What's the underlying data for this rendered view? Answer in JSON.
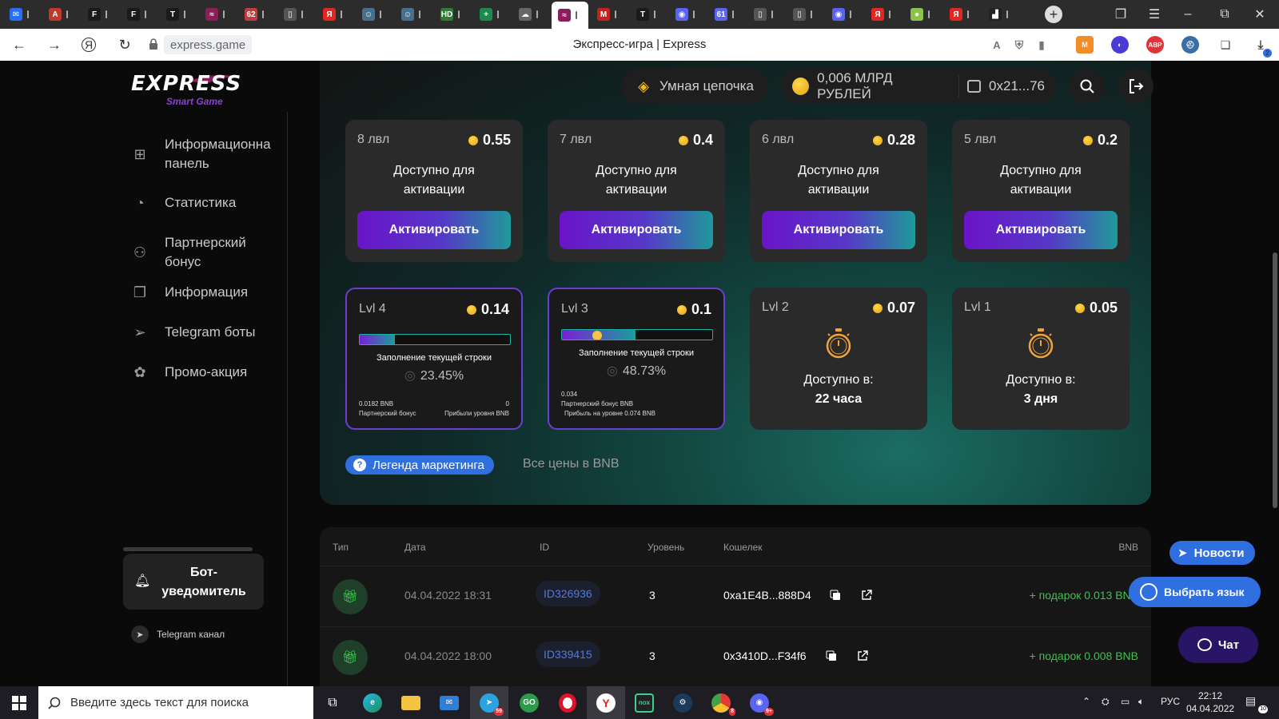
{
  "browser": {
    "tabs": [
      {
        "icon": "msg-icon",
        "color": "#2a6df5",
        "glyph": "✉",
        "badge": ""
      },
      {
        "icon": "app-icon",
        "color": "#c0392b",
        "glyph": "A",
        "badge": ""
      },
      {
        "icon": "f-icon",
        "color": "#1a1a1a",
        "glyph": "F",
        "badge": ""
      },
      {
        "icon": "f-icon",
        "color": "#1a1a1a",
        "glyph": "F",
        "badge": ""
      },
      {
        "icon": "t-icon",
        "color": "#1a1a1a",
        "glyph": "T",
        "badge": ""
      },
      {
        "icon": "express-icon",
        "color": "#8b1d5a",
        "glyph": "≈",
        "badge": ""
      },
      {
        "icon": "badge-icon",
        "color": "#c23b3b",
        "glyph": "62",
        "badge": "62"
      },
      {
        "icon": "doc-icon",
        "color": "#555",
        "glyph": "▯",
        "badge": ""
      },
      {
        "icon": "yandex-icon",
        "color": "#e52620",
        "glyph": "Я",
        "badge": ""
      },
      {
        "icon": "mask-icon",
        "color": "#4a6f8a",
        "glyph": "☺",
        "badge": ""
      },
      {
        "icon": "mask-icon",
        "color": "#4a6f8a",
        "glyph": "☺",
        "badge": ""
      },
      {
        "icon": "hd-icon",
        "color": "#2e7d32",
        "glyph": "HD",
        "badge": ""
      },
      {
        "icon": "sheet-icon",
        "color": "#1b8a4a",
        "glyph": "+",
        "badge": ""
      },
      {
        "icon": "cloud-icon",
        "color": "#666",
        "glyph": "☁",
        "badge": ""
      },
      {
        "icon": "express-icon",
        "color": "#8b1d5a",
        "glyph": "≈",
        "badge": ""
      },
      {
        "icon": "gmail-icon",
        "color": "#c5221f",
        "glyph": "M",
        "badge": ""
      },
      {
        "icon": "t-icon",
        "color": "#1a1a1a",
        "glyph": "T",
        "badge": ""
      },
      {
        "icon": "discord-icon",
        "color": "#5865f2",
        "glyph": "◉",
        "badge": ""
      },
      {
        "icon": "badge-icon",
        "color": "#5865f2",
        "glyph": "61",
        "badge": "61"
      },
      {
        "icon": "doc-icon",
        "color": "#555",
        "glyph": "▯",
        "badge": ""
      },
      {
        "icon": "doc-icon",
        "color": "#555",
        "glyph": "▯",
        "badge": ""
      },
      {
        "icon": "discord-icon",
        "color": "#5865f2",
        "glyph": "◉",
        "badge": ""
      },
      {
        "icon": "yandex-icon",
        "color": "#e52620",
        "glyph": "Я",
        "badge": ""
      },
      {
        "icon": "ball-icon",
        "color": "#8bc34a",
        "glyph": "●",
        "badge": ""
      },
      {
        "icon": "yandex-icon",
        "color": "#e52620",
        "glyph": "Я",
        "badge": ""
      },
      {
        "icon": "chart-icon",
        "color": "#222",
        "glyph": "▟",
        "badge": ""
      }
    ],
    "url": "express.game",
    "page_title": "Экспресс-игра | Express",
    "download_count": "2"
  },
  "header": {
    "logo_text": "EXPRESS",
    "logo_sub": "Smart Game",
    "chain_label": "Умная цепочка",
    "balance": "0,006 МЛРД РУБЛЕЙ",
    "wallet": "0x21...76"
  },
  "sidebar": {
    "items": [
      {
        "label": "Информационна панель",
        "icon": "dashboard-icon"
      },
      {
        "label": "Статистика",
        "icon": "stats-icon"
      },
      {
        "label": "Партнерский бонус",
        "icon": "partner-icon"
      },
      {
        "label": "Информация",
        "icon": "info-icon"
      },
      {
        "label": "Telegram боты",
        "icon": "telegram-icon"
      },
      {
        "label": "Промо-акция",
        "icon": "promo-icon"
      }
    ],
    "bot_label": "Бот-уведомитель",
    "telegram_channel": "Telegram канал"
  },
  "levels_top": [
    {
      "level": "8 лвл",
      "price": "0.55",
      "status": "Доступно для активации",
      "button": "Активировать"
    },
    {
      "level": "7 лвл",
      "price": "0.4",
      "status": "Доступно для активации",
      "button": "Активировать"
    },
    {
      "level": "6 лвл",
      "price": "0.28",
      "status": "Доступно для активации",
      "button": "Активировать"
    },
    {
      "level": "5 лвл",
      "price": "0.2",
      "status": "Доступно для активации",
      "button": "Активировать"
    }
  ],
  "levels_active": [
    {
      "level": "Lvl 4",
      "price": "0.14",
      "fill_caption": "Заполнение текущей строки",
      "percent": "23.45%",
      "progress": 0.2345,
      "left_value": "0.0182 BNB",
      "left_label": "Партнерский бонус",
      "right_value": "0",
      "right_label": "Прибыли уровня BNB"
    },
    {
      "level": "Lvl 3",
      "price": "0.1",
      "fill_caption": "Заполнение текущей строки",
      "percent": "48.73%",
      "progress": 0.4873,
      "left_value": "0.034",
      "left_label": "Партнерский бонус BNB",
      "right_label": "Прибыль на уровне 0.074 BNB"
    }
  ],
  "levels_timer": [
    {
      "level": "Lvl 2",
      "price": "0.07",
      "label": "Доступно в:",
      "time": "22 часа"
    },
    {
      "level": "Lvl 1",
      "price": "0.05",
      "label": "Доступно в:",
      "time": "3 дня"
    }
  ],
  "legend_button": "Легенда маркетинга",
  "prices_note": "Все цены в BNB",
  "table": {
    "headers": {
      "type": "Тип",
      "date": "Дата",
      "id": "ID",
      "level": "Уровень",
      "wallet": "Кошелек",
      "bnb": "BNB"
    },
    "rows": [
      {
        "date": "04.04.2022 18:31",
        "id": "ID326936",
        "level": "3",
        "wallet": "0xa1E4B...888D4",
        "bnb": "+ подарок 0.013 BNB"
      },
      {
        "date": "04.04.2022 18:00",
        "id": "ID339415",
        "level": "3",
        "wallet": "0x3410D...F34f6",
        "bnb": "+ подарок 0.008 BNB"
      }
    ]
  },
  "float": {
    "news": "Новости",
    "lang": "Выбрать язык",
    "chat": "Чат"
  },
  "taskbar": {
    "search_placeholder": "Введите здесь текст для поиска",
    "telegram_badge": "59",
    "chrome_badge": "8",
    "discord_badge": "9+",
    "lang": "РУС",
    "time": "22:12",
    "date": "04.04.2022",
    "notif_count": "10"
  }
}
